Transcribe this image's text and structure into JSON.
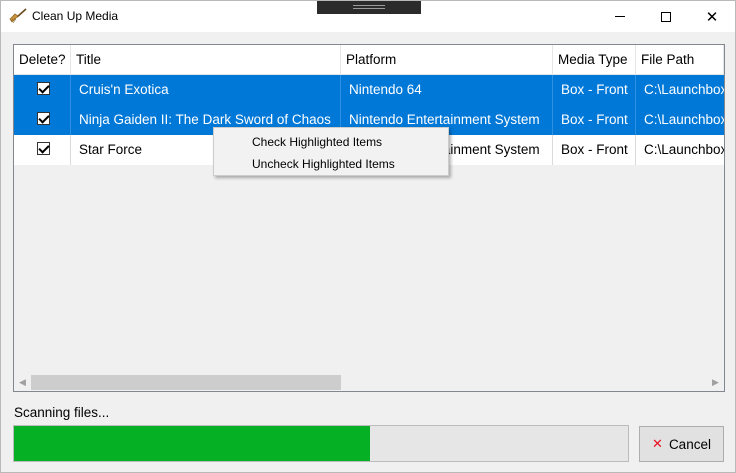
{
  "window": {
    "title": "Clean Up Media",
    "minimize_glyph": "",
    "close_glyph": "✕"
  },
  "columns": [
    "Delete?",
    "Title",
    "Platform",
    "Media Type",
    "File Path"
  ],
  "rows": [
    {
      "checked": true,
      "title": "Cruis'n Exotica",
      "platform": "Nintendo 64",
      "media_type": "Box - Front",
      "file_path": "C:\\Launchbox",
      "selected": true
    },
    {
      "checked": true,
      "title": "Ninja Gaiden II: The Dark Sword of Chaos",
      "platform": "Nintendo Entertainment System",
      "media_type": "Box - Front",
      "file_path": "C:\\Launchbox",
      "selected": true
    },
    {
      "checked": true,
      "title": "Star Force",
      "platform": "Nintendo Entertainment System",
      "media_type": "Box - Front",
      "file_path": "C:\\Launchbox",
      "selected": false
    }
  ],
  "context_menu": {
    "items": [
      "Check Highlighted Items",
      "Uncheck Highlighted Items"
    ]
  },
  "status_text": "Scanning files...",
  "progress": {
    "fraction": 0.58,
    "fill_color": "#06b025"
  },
  "cancel_button": {
    "label": "Cancel",
    "icon": "x-icon"
  },
  "colors": {
    "selection": "#0078d7",
    "progress": "#06b025",
    "cancel_icon": "#e81123"
  }
}
